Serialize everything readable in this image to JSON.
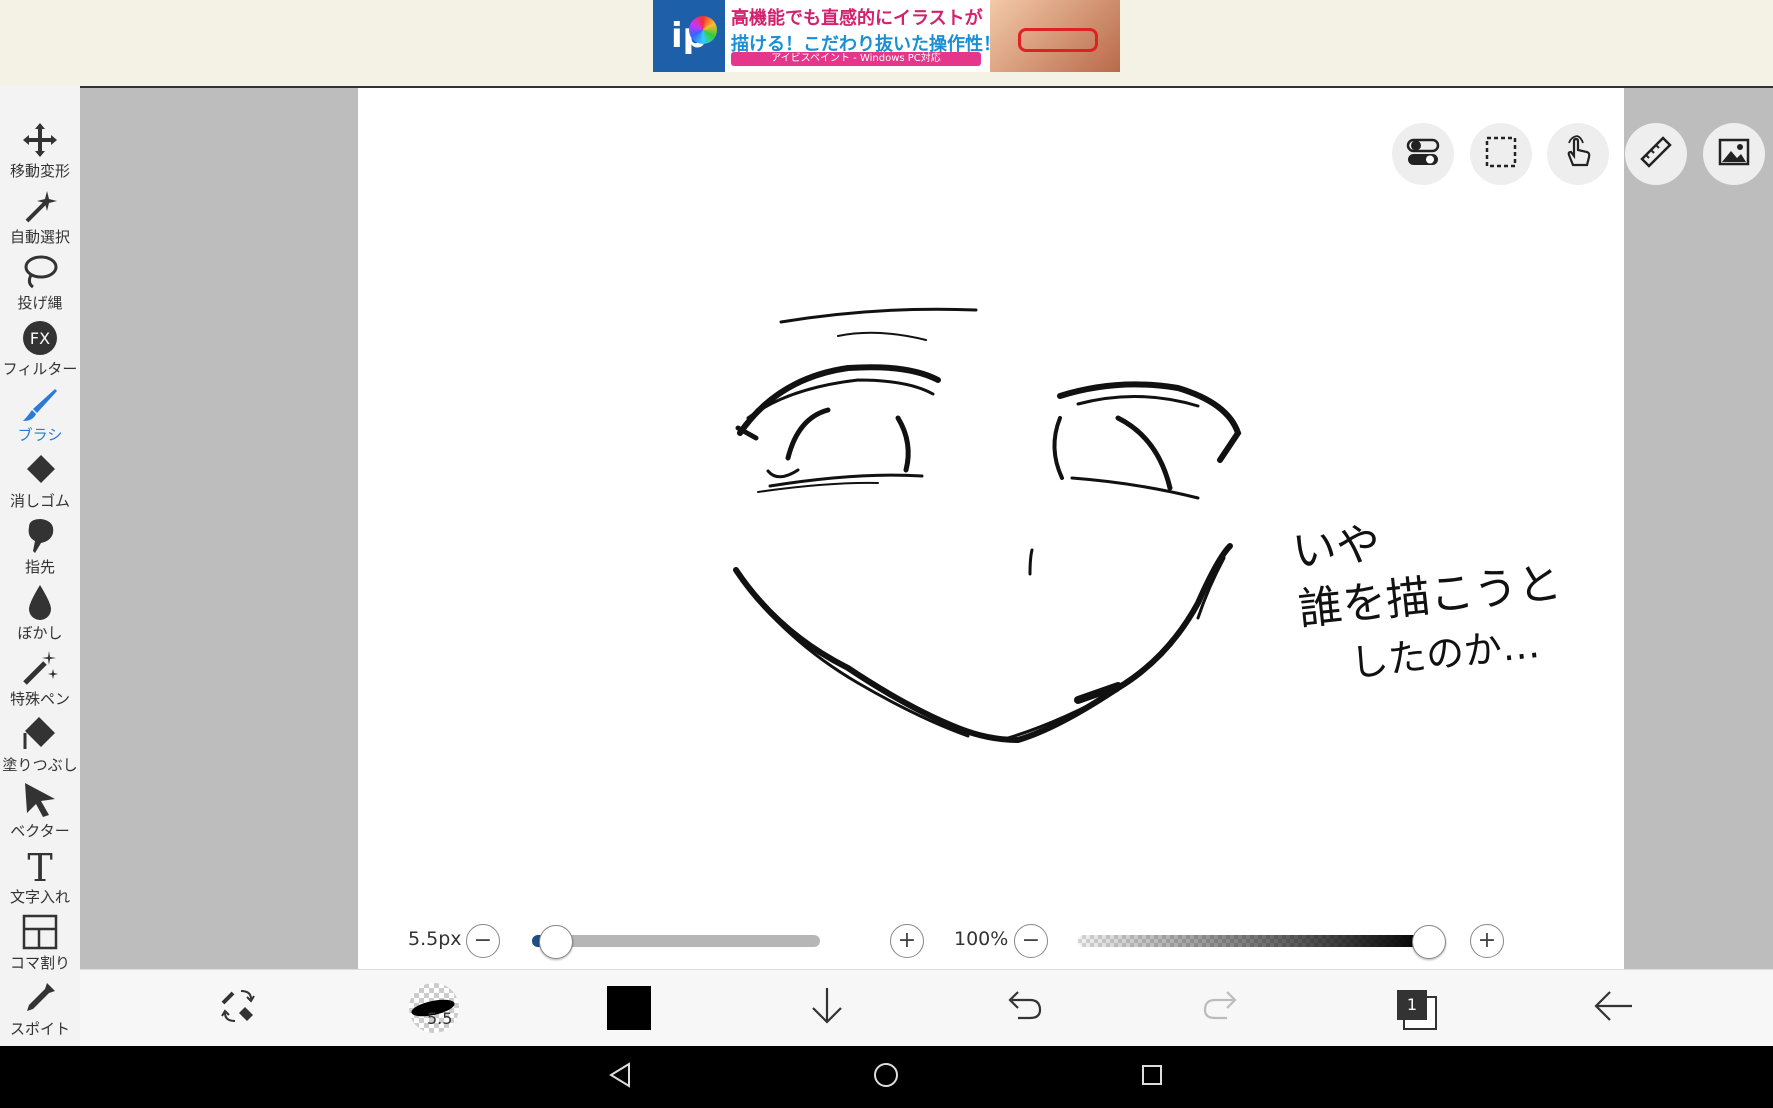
{
  "ad": {
    "logo_text": "ip",
    "line1": "高機能でも直感的にイラストが",
    "line2": "描ける！こだわり抜いた操作性！",
    "strip": "アイビスペイント - Windows PC対応"
  },
  "tools": [
    {
      "icon": "move-transform-icon",
      "label": "移動変形"
    },
    {
      "icon": "magic-wand-icon",
      "label": "自動選択"
    },
    {
      "icon": "lasso-icon",
      "label": "投げ縄"
    },
    {
      "icon": "fx-filter-icon",
      "label": "フィルター"
    },
    {
      "icon": "brush-icon",
      "label": "ブラシ",
      "active": true
    },
    {
      "icon": "eraser-icon",
      "label": "消しゴム"
    },
    {
      "icon": "finger-smudge-icon",
      "label": "指先"
    },
    {
      "icon": "blur-drop-icon",
      "label": "ぼかし"
    },
    {
      "icon": "special-pen-icon",
      "label": "特殊ペン"
    },
    {
      "icon": "fill-bucket-icon",
      "label": "塗りつぶし"
    },
    {
      "icon": "vector-cursor-icon",
      "label": "ベクター"
    },
    {
      "icon": "text-icon",
      "label": "文字入れ"
    },
    {
      "icon": "frame-divider-icon",
      "label": "コマ割り"
    },
    {
      "icon": "eyedropper-icon",
      "label": "スポイト"
    }
  ],
  "canvas_tools": [
    "toggle-icon",
    "selection-rect-icon",
    "hand-touch-icon",
    "ruler-icon",
    "image-icon"
  ],
  "handwriting": {
    "line1": "いや",
    "line2": "誰を描こうと",
    "line3": "したのか…"
  },
  "brush_size": {
    "label": "5.5px",
    "value_fraction": 0.03
  },
  "opacity": {
    "label": "100%",
    "value_fraction": 1.0
  },
  "bottom": {
    "brush_preview_value": "5.5",
    "current_color": "#000000",
    "layer_count": "1"
  },
  "colors": {
    "accent": "#2a7ad8",
    "slider_fill": "#1f4c84"
  }
}
